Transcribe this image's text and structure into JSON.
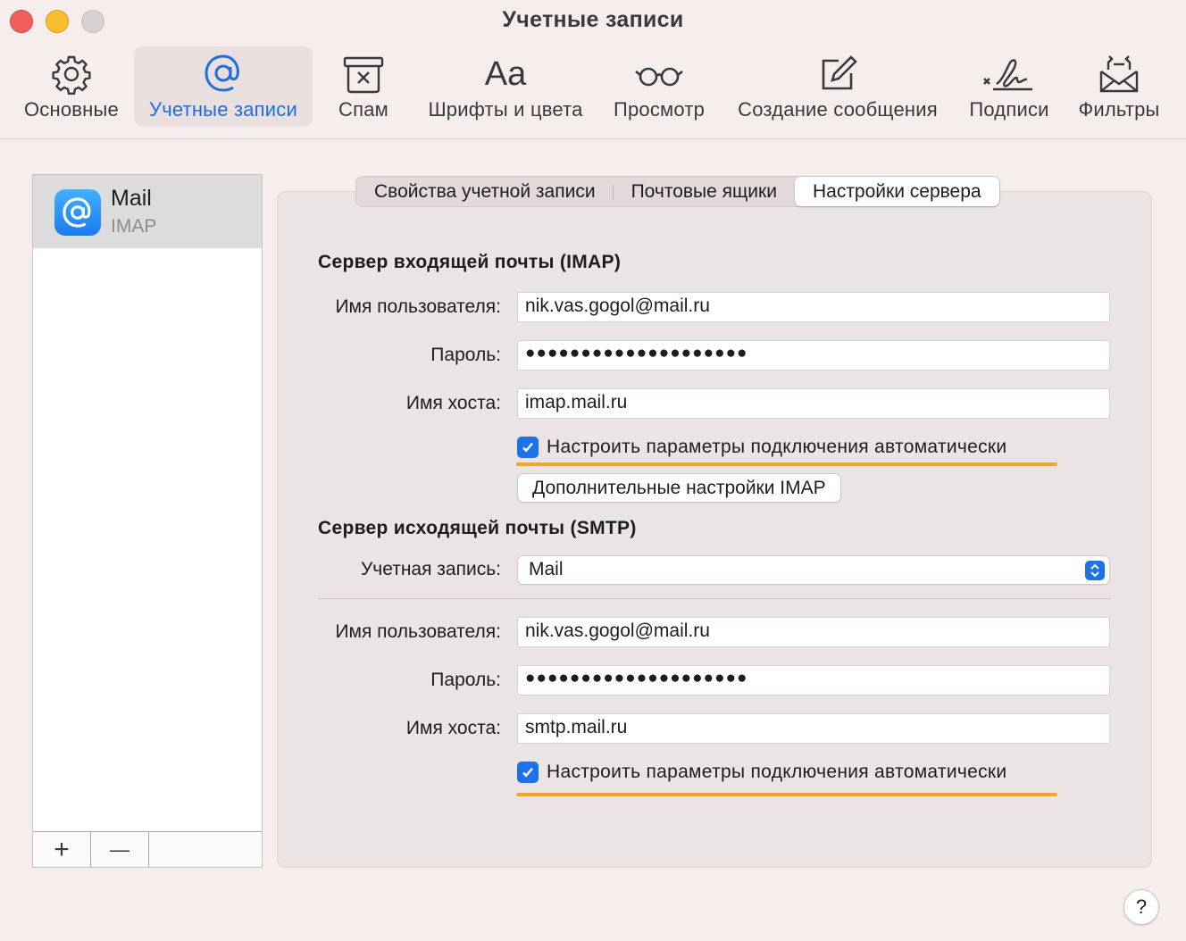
{
  "window": {
    "title": "Учетные записи"
  },
  "toolbar": {
    "items": [
      {
        "label": "Основные",
        "icon": "gear-icon"
      },
      {
        "label": "Учетные записи",
        "icon": "at-icon",
        "active": true
      },
      {
        "label": "Спам",
        "icon": "junk-bin-icon"
      },
      {
        "label": "Шрифты и цвета",
        "icon": "fonts-icon"
      },
      {
        "label": "Просмотр",
        "icon": "glasses-icon"
      },
      {
        "label": "Создание сообщения",
        "icon": "compose-icon"
      },
      {
        "label": "Подписи",
        "icon": "signature-icon"
      },
      {
        "label": "Фильтры",
        "icon": "rules-icon"
      }
    ]
  },
  "sidebar": {
    "accounts": [
      {
        "name": "Mail",
        "type": "IMAP",
        "icon": "mail-at-icon"
      }
    ],
    "add_label": "+",
    "remove_label": "—"
  },
  "tabs": [
    {
      "label": "Свойства учетной записи"
    },
    {
      "label": "Почтовые ящики"
    },
    {
      "label": "Настройки сервера",
      "active": true
    }
  ],
  "incoming": {
    "title": "Сервер входящей почты (IMAP)",
    "username_label": "Имя пользователя:",
    "username": "nik.vas.gogol@mail.ru",
    "password_label": "Пароль:",
    "password": "●●●●●●●●●●●●●●●●●●●●",
    "host_label": "Имя хоста:",
    "host": "imap.mail.ru",
    "auto_label": "Настроить параметры подключения автоматически",
    "auto_checked": true,
    "advanced_button": "Дополнительные настройки IMAP"
  },
  "outgoing": {
    "title": "Сервер исходящей почты (SMTP)",
    "account_label": "Учетная запись:",
    "account_value": "Mail",
    "username_label": "Имя пользователя:",
    "username": "nik.vas.gogol@mail.ru",
    "password_label": "Пароль:",
    "password": "●●●●●●●●●●●●●●●●●●●●",
    "host_label": "Имя хоста:",
    "host": "smtp.mail.ru",
    "auto_label": "Настроить параметры подключения автоматически",
    "auto_checked": true
  },
  "help_label": "?",
  "colors": {
    "accent": "#1b72ea",
    "highlight": "#f5a623",
    "background": "#f6eded"
  }
}
